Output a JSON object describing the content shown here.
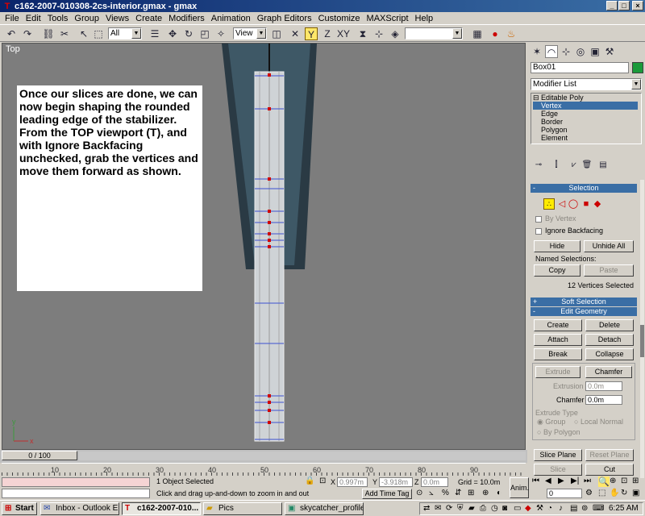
{
  "window": {
    "title": "c162-2007-010308-2cs-interior.gmax - gmax"
  },
  "menu": [
    "File",
    "Edit",
    "Tools",
    "Group",
    "Views",
    "Create",
    "Modifiers",
    "Animation",
    "Graph Editors",
    "Customize",
    "MAXScript",
    "Help"
  ],
  "toolbar": {
    "selection_filter": "All",
    "ref_coord": "View",
    "named_sel": ""
  },
  "viewport": {
    "label": "Top"
  },
  "tutorial_text": "Once our slices are done, we can now begin shaping the rounded leading edge of the stabilizer.  From the TOP viewport (T), and with Ignore Backfacing unchecked, grab the vertices and move them forward as shown.",
  "panel": {
    "object_name": "Box01",
    "object_color": "#1a9a3a",
    "modifier_list": "Modifier List",
    "stack": [
      "Editable Poly",
      "Vertex",
      "Edge",
      "Border",
      "Polygon",
      "Element"
    ],
    "selection": {
      "title": "Selection",
      "by_vertex": "By Vertex",
      "ignore_backfacing": "Ignore Backfacing",
      "hide": "Hide",
      "unhide_all": "Unhide All",
      "named_selections": "Named Selections:",
      "copy": "Copy",
      "paste": "Paste",
      "count": "12 Vertices Selected"
    },
    "soft_selection": "Soft Selection",
    "edit_geometry": {
      "title": "Edit Geometry",
      "create": "Create",
      "delete": "Delete",
      "attach": "Attach",
      "detach": "Detach",
      "break": "Break",
      "collapse": "Collapse",
      "extrude": "Extrude",
      "chamfer": "Chamfer",
      "extrusion_label": "Extrusion",
      "extrusion_value": "0.0m",
      "chamfer_label": "Chamfer",
      "chamfer_value": "0.0m",
      "extrude_type": "Extrude Type",
      "group": "Group",
      "local_normal": "Local Normal",
      "by_polygon": "By Polygon",
      "slice_plane": "Slice Plane",
      "reset_plane": "Reset Plane",
      "slice": "Slice",
      "cut": "Cut"
    }
  },
  "timeline": {
    "slider": "0 / 100",
    "ticks": [
      "10",
      "20",
      "30",
      "40",
      "50",
      "60",
      "70",
      "80",
      "90"
    ]
  },
  "status": {
    "selected": "1 Object Selected",
    "prompt": "Click and drag up-and-down to zoom in and out",
    "x_label": "X",
    "x_value": "0.997m",
    "y_label": "Y",
    "y_value": "-3.918m",
    "z_label": "Z",
    "z_value": "0.0m",
    "grid": "Grid = 10.0m",
    "add_time_tag": "Add Time Tag",
    "anim": "Anim.",
    "frame": "0"
  },
  "taskbar": {
    "start": "Start",
    "tasks": [
      "Inbox - Outlook E...",
      "c162-2007-010...",
      "Pics",
      "skycatcher_profile..."
    ],
    "clock": "6:25 AM"
  }
}
